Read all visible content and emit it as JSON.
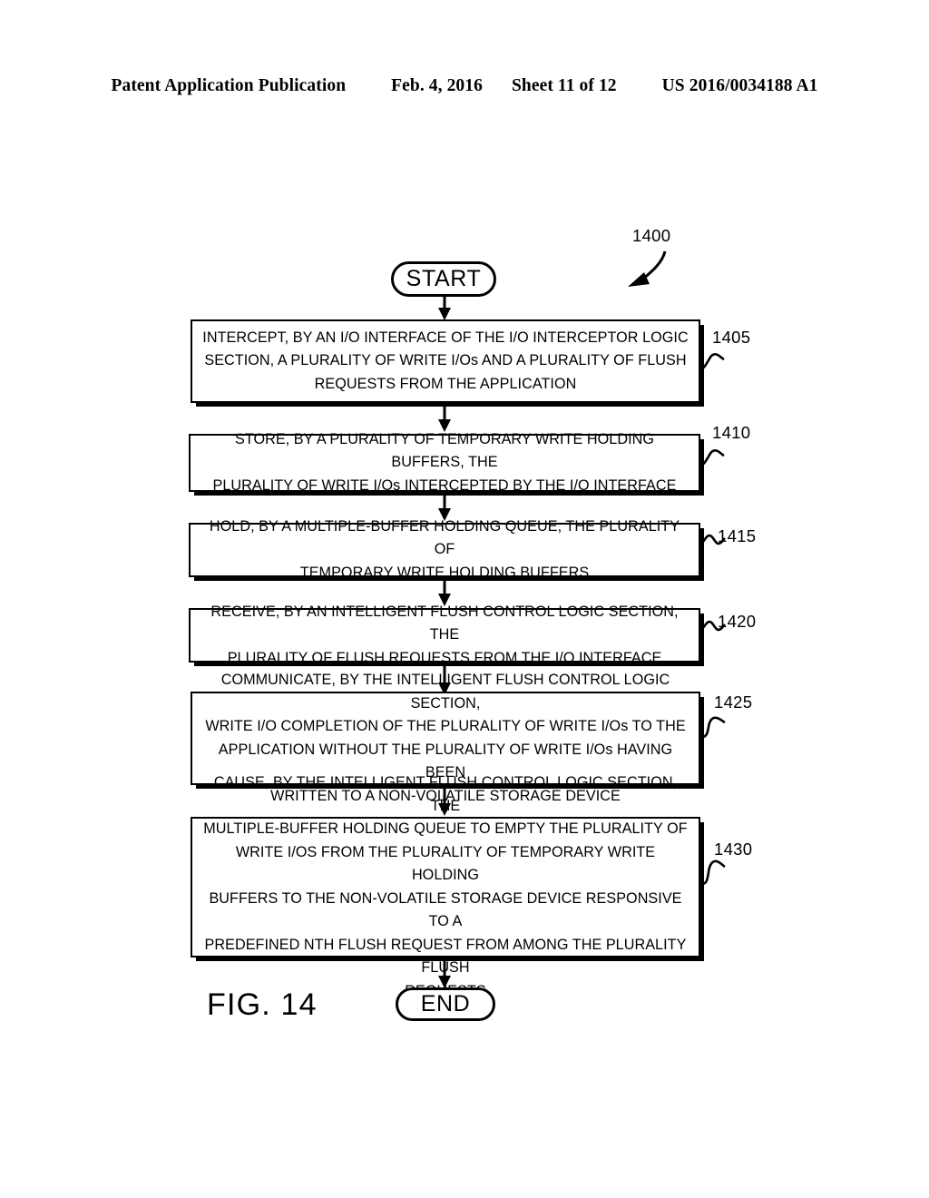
{
  "header": {
    "publication": "Patent Application Publication",
    "date": "Feb. 4, 2016",
    "sheet": "Sheet 11 of 12",
    "docnum": "US 2016/0034188 A1"
  },
  "figure": {
    "caption": "FIG. 14",
    "diagram_ref": "1400"
  },
  "flow": {
    "start_label": "START",
    "end_label": "END",
    "steps": [
      {
        "ref": "1405",
        "text": "INTERCEPT, BY AN I/O INTERFACE OF THE I/O INTERCEPTOR LOGIC\nSECTION, A PLURALITY OF WRITE I/Os AND A PLURALITY OF FLUSH\nREQUESTS FROM THE APPLICATION"
      },
      {
        "ref": "1410",
        "text": "STORE, BY A PLURALITY OF TEMPORARY WRITE HOLDING BUFFERS, THE\nPLURALITY OF WRITE I/Os INTERCEPTED BY THE I/O INTERFACE"
      },
      {
        "ref": "1415",
        "text": "HOLD, BY A MULTIPLE-BUFFER HOLDING QUEUE, THE PLURALITY OF\nTEMPORARY WRITE HOLDING BUFFERS"
      },
      {
        "ref": "1420",
        "text": "RECEIVE, BY AN INTELLIGENT FLUSH CONTROL LOGIC SECTION, THE\nPLURALITY OF FLUSH REQUESTS FROM THE I/O INTERFACE"
      },
      {
        "ref": "1425",
        "text": "COMMUNICATE, BY THE INTELLIGENT FLUSH CONTROL LOGIC SECTION,\nWRITE I/O COMPLETION OF THE PLURALITY OF WRITE I/Os TO THE\nAPPLICATION WITHOUT THE PLURALITY OF WRITE I/Os HAVING BEEN\nWRITTEN TO A NON-VOLATILE STORAGE DEVICE"
      },
      {
        "ref": "1430",
        "text": "CAUSE, BY THE INTELLIGENT FLUSH CONTROL LOGIC SECTION, THE\nMULTIPLE-BUFFER HOLDING QUEUE TO EMPTY THE PLURALITY OF\nWRITE I/OS FROM THE PLURALITY OF TEMPORARY WRITE HOLDING\nBUFFERS TO THE NON-VOLATILE STORAGE DEVICE RESPONSIVE TO A\nPREDEFINED NTH FLUSH REQUEST FROM AMONG THE PLURALITY FLUSH\nREQUESTS"
      }
    ]
  },
  "colors": {
    "ink": "#000000",
    "paper": "#ffffff"
  }
}
